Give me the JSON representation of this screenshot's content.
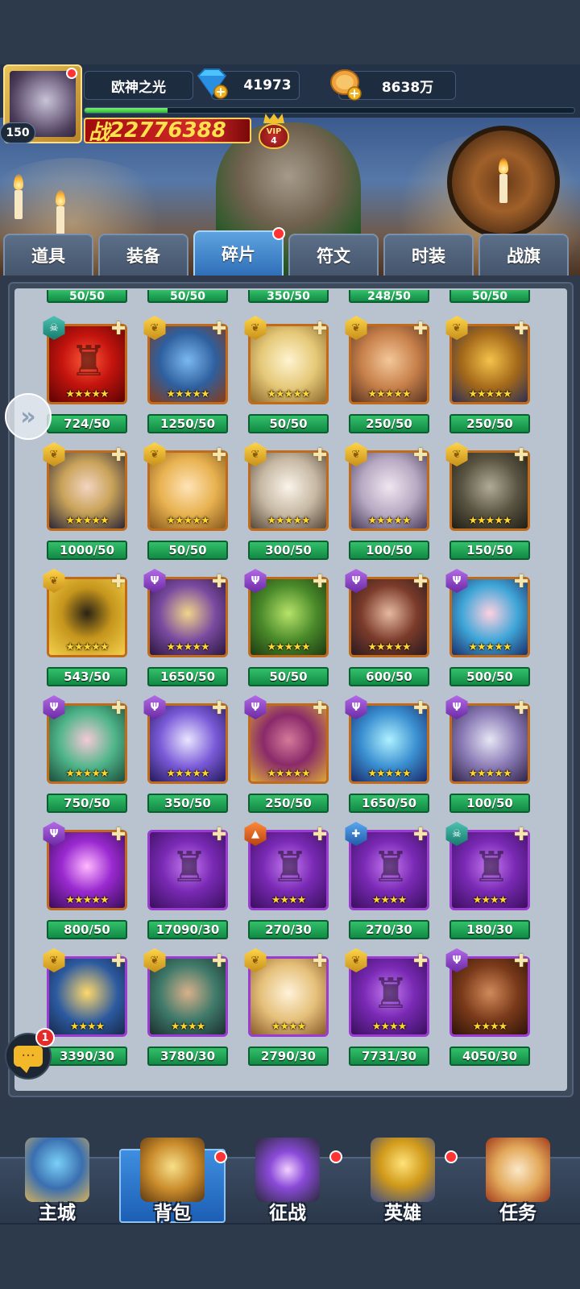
{
  "player": {
    "name": "欧神之光",
    "level": "150",
    "power_prefix": "战",
    "power": "22776388",
    "vip_label": "VIP",
    "vip_level": "4",
    "diamonds": "41973",
    "gold": "8638万",
    "exp_progress": 0.17
  },
  "tabs": [
    {
      "label": "道具"
    },
    {
      "label": "装备"
    },
    {
      "label": "碎片",
      "active": true,
      "has_notification": true
    },
    {
      "label": "符文"
    },
    {
      "label": "时装"
    },
    {
      "label": "战旗"
    }
  ],
  "partial_top_counts": [
    "50/50",
    "50/50",
    "350/50",
    "248/50",
    "50/50"
  ],
  "fragments": [
    {
      "count": "724/50",
      "faction": "teal",
      "faction_icon": "skull-icon",
      "stars": "★★★★★",
      "frame": "orange",
      "art": "red-puzzle"
    },
    {
      "count": "1250/50",
      "faction": "gold",
      "faction_icon": "wing-icon",
      "stars": "★★★★★",
      "frame": "orange",
      "art": "blue-troll"
    },
    {
      "count": "50/50",
      "faction": "gold",
      "faction_icon": "wing-icon",
      "stars": "★★★★★",
      "frame": "orange",
      "art": "angel"
    },
    {
      "count": "250/50",
      "faction": "gold",
      "faction_icon": "wing-icon",
      "stars": "★★★★★",
      "frame": "orange",
      "art": "elf-prince"
    },
    {
      "count": "250/50",
      "faction": "gold",
      "faction_icon": "wing-icon",
      "stars": "★★★★★",
      "frame": "orange",
      "art": "anubis"
    },
    {
      "count": "1000/50",
      "faction": "gold",
      "faction_icon": "wing-icon",
      "stars": "★★★★★",
      "frame": "orange",
      "art": "hooded-girl"
    },
    {
      "count": "50/50",
      "faction": "gold",
      "faction_icon": "wing-icon",
      "stars": "★★★★★",
      "frame": "orange",
      "art": "blonde-girl"
    },
    {
      "count": "300/50",
      "faction": "gold",
      "faction_icon": "wing-icon",
      "stars": "★★★★★",
      "frame": "orange",
      "art": "white-hair"
    },
    {
      "count": "100/50",
      "faction": "gold",
      "faction_icon": "wing-icon",
      "stars": "★★★★★",
      "frame": "orange",
      "art": "silver-elf"
    },
    {
      "count": "150/50",
      "faction": "gold",
      "faction_icon": "wing-icon",
      "stars": "★★★★★",
      "frame": "orange",
      "art": "dark-hood"
    },
    {
      "count": "543/50",
      "faction": "gold",
      "faction_icon": "wing-icon",
      "stars": "★★★★★",
      "frame": "orange",
      "art": "gold-helm"
    },
    {
      "count": "1650/50",
      "faction": "purple",
      "faction_icon": "trident-icon",
      "stars": "★★★★★",
      "frame": "orange",
      "art": "masked-rogue"
    },
    {
      "count": "50/50",
      "faction": "purple",
      "faction_icon": "trident-icon",
      "stars": "★★★★★",
      "frame": "orange",
      "art": "green-toad"
    },
    {
      "count": "600/50",
      "faction": "purple",
      "faction_icon": "trident-icon",
      "stars": "★★★★★",
      "frame": "orange",
      "art": "dark-knight"
    },
    {
      "count": "500/50",
      "faction": "purple",
      "faction_icon": "trident-icon",
      "stars": "★★★★★",
      "frame": "orange",
      "art": "sea-queen"
    },
    {
      "count": "750/50",
      "faction": "purple",
      "faction_icon": "trident-icon",
      "stars": "★★★★★",
      "frame": "orange",
      "art": "medusa"
    },
    {
      "count": "350/50",
      "faction": "purple",
      "faction_icon": "trident-icon",
      "stars": "★★★★★",
      "frame": "orange",
      "art": "witch"
    },
    {
      "count": "250/50",
      "faction": "purple",
      "faction_icon": "trident-icon",
      "stars": "★★★★★",
      "frame": "orange",
      "art": "pharaoh"
    },
    {
      "count": "1650/50",
      "faction": "purple",
      "faction_icon": "trident-icon",
      "stars": "★★★★★",
      "frame": "orange",
      "art": "ice-spirit"
    },
    {
      "count": "100/50",
      "faction": "purple",
      "faction_icon": "trident-icon",
      "stars": "★★★★★",
      "frame": "orange",
      "art": "dark-elf"
    },
    {
      "count": "800/50",
      "faction": "purple",
      "faction_icon": "trident-icon",
      "stars": "★★★★★",
      "frame": "orange",
      "art": "purple-helm"
    },
    {
      "count": "17090/30",
      "faction": "",
      "faction_icon": "",
      "stars": "",
      "frame": "purple",
      "art": "purple-puzzle"
    },
    {
      "count": "270/30",
      "faction": "orange",
      "faction_icon": "flame-icon",
      "stars": "★★★★",
      "frame": "purple",
      "art": "purple-puzzle"
    },
    {
      "count": "270/30",
      "faction": "blue",
      "faction_icon": "cross-icon",
      "stars": "★★★★",
      "frame": "purple",
      "art": "purple-puzzle"
    },
    {
      "count": "180/30",
      "faction": "teal",
      "faction_icon": "skull-icon",
      "stars": "★★★★",
      "frame": "purple",
      "art": "purple-puzzle"
    },
    {
      "count": "3390/30",
      "faction": "gold",
      "faction_icon": "wing-icon",
      "stars": "★★★★",
      "frame": "purple",
      "art": "gold-warrior"
    },
    {
      "count": "3780/30",
      "faction": "gold",
      "faction_icon": "wing-icon",
      "stars": "★★★★",
      "frame": "purple",
      "art": "orc"
    },
    {
      "count": "2790/30",
      "faction": "gold",
      "faction_icon": "wing-icon",
      "stars": "★★★★",
      "frame": "purple",
      "art": "priestess"
    },
    {
      "count": "7731/30",
      "faction": "gold",
      "faction_icon": "wing-icon",
      "stars": "★★★★",
      "frame": "purple",
      "art": "purple-puzzle"
    },
    {
      "count": "4050/30",
      "faction": "purple",
      "faction_icon": "trident-icon",
      "stars": "★★★★",
      "frame": "purple",
      "art": "bear"
    }
  ],
  "chat": {
    "badge": "1"
  },
  "nav": [
    {
      "label": "主城",
      "icon": "castle-icon"
    },
    {
      "label": "背包",
      "icon": "chest-icon",
      "active": true,
      "has_notification": true
    },
    {
      "label": "征战",
      "icon": "portal-icon",
      "has_notification": true
    },
    {
      "label": "英雄",
      "icon": "helmet-icon",
      "has_notification": true
    },
    {
      "label": "任务",
      "icon": "scroll-icon"
    }
  ],
  "colors": {
    "count_bar": "#1fa055",
    "tab_active": "#3f8ee0",
    "frame_orange": "#c06a1a",
    "frame_purple": "#9c3bd0"
  }
}
